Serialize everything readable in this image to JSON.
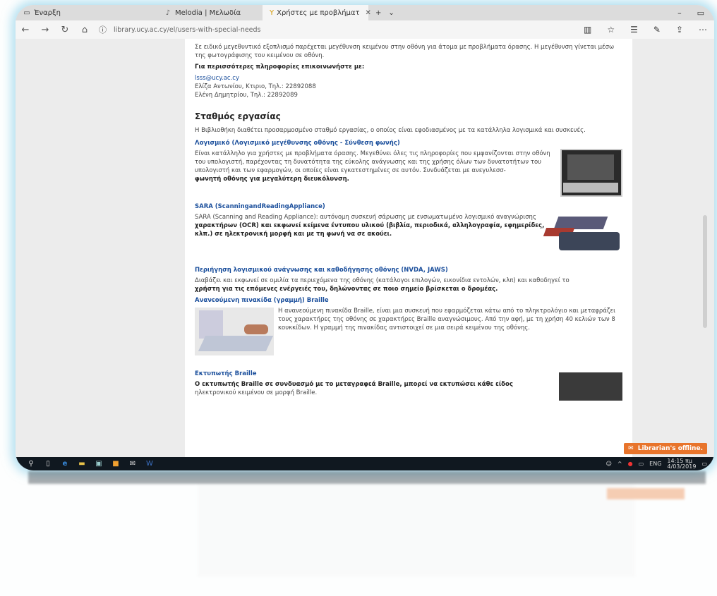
{
  "tabs": [
    {
      "label": "Έναρξη",
      "icon": "edge-page-icon"
    },
    {
      "label": "Melodia | Μελωδία",
      "icon": "music-icon"
    },
    {
      "label": "Χρήστες με προβλήματ",
      "icon": "ucy-library-icon"
    }
  ],
  "window_controls": [
    "–",
    "▭"
  ],
  "address": {
    "url": "library.ucy.ac.cy/el/users-with-special-needs"
  },
  "page": {
    "intro_text": "Σε ειδικό μεγεθυντικό εξοπλισμό παρέχεται μεγέθυνση κειμένου στην οθόνη για άτομα με προβλήματα όρασης. Η μεγέθυνση γίνεται μέσω της φωτογράφισης του κειμένου σε οθόνη.",
    "contact_heading": "Για περισσότερες πληροφορίες επικοινωνήστε με:",
    "contact_email": "lsss@ucy.ac.cy",
    "contact_line1": "Ελίζα Αντωνίου, Κτιριο, Τηλ.: 22892088",
    "contact_line2": "Ελένη Δημητρίου, Τηλ.: 22892089",
    "workstations_title": "Σταθμός εργασίας",
    "workstations_intro": "Η Βιβλιοθήκη διαθέτει προσαρμοσμένο σταθμό εργασίας, ο οποίος είναι εφοδιασμένος με τα κατάλληλα λογισμικά και συσκευές.",
    "sections": [
      {
        "title": "Λογισμικό (Λογισμικό μεγέθυνσης οθόνης - Σύνθεση φωνής)",
        "body": "Είναι κατάλληλο για χρήστες με προβλήματα όρασης. Μεγεθύνει όλες τις πληροφορίες που εμφανίζονται στην οθόνη του υπολογιστή, παρέχοντας τη δυνατότητα της εύκολης ανάγνωσης και της χρήσης όλων των δυνατοτήτων του υπολογιστή και των εφαρμογών, οι οποίες είναι εγκατεστημένες σε αυτόν. Συνδυάζεται με ανεγυλεσσ-",
        "body_tail": "φωνητή οθόνης για μεγαλύτερη διευκόλυνση.",
        "image": "workstation-photo"
      },
      {
        "title": "SARA (ScanningandReadingAppliance)",
        "body": "SARA (Scanning and Reading Appliance): αυτόνομη συσκευή σάρωσης με ενσωματωμένο λογισμικό αναγνώρισης",
        "body_tail": "χαρακτήρων (OCR) και εκφωνεί κείμενα έντυπου υλικού (βιβλία, περιοδικά, αλληλογραφία, εφημερίδες, κλπ.) σε ηλεκτρονική μορφή και με τη φωνή να σε ακούει.",
        "image": "sara-scanner-photo"
      },
      {
        "title": "Περιήγηση λογισμικού ανάγνωσης και καθοδήγησης οθόνης (NVDA, JAWS)",
        "body": "Διαβάζει και εκφωνεί σε ομιλία τα περιεχόμενα της οθόνης (κατάλογοι επιλογών, εικονίδια εντολών, κλπ) και καθοδηγεί το",
        "body_tail": "χρήστη για τις επόμενες ενέργειές του, δηλώνοντας σε ποιο σημείο βρίσκεται ο δρομέας.",
        "image": ""
      },
      {
        "title": "Ανανεούμενη πινακίδα (γραμμή) Braille",
        "body": "Η ανανεούμενη πινακίδα Braille, είναι μια συσκευή που εφαρμόζεται κάτω από το πληκτρολόγιο και μεταφράζει τους χαρακτήρες της οθόνης σε χαρακτήρες Braille αναγνώσιμους. Από την αφή, με τη χρήση 40 κελιών των 8 κουκκίδων. Η γραμμή της πινακίδας αντιστοιχεί σε μια σειρά κειμένου της οθόνης.",
        "body_tail": "",
        "image": "braille-display-photo"
      },
      {
        "title": "Εκτυπωτής Braille",
        "body": "Ο εκτυπωτής Braille σε συνδυασμό με το μεταγραφεά Braille, μπορεί να εκτυπώσει κάθε είδος",
        "body_tail": "ηλεκτρονικού κειμένου σε μορφή Braille.",
        "image": "braille-printer-photo"
      }
    ],
    "chat_label": "Librarian's offline."
  },
  "taskbar": {
    "lang": "ENG",
    "time": "14:15 πμ",
    "date": "4/03/2019"
  },
  "colors": {
    "link": "#1b4f9c",
    "taskbar": "#101820",
    "chat": "#e8742b",
    "glow": "#78c8e6"
  }
}
